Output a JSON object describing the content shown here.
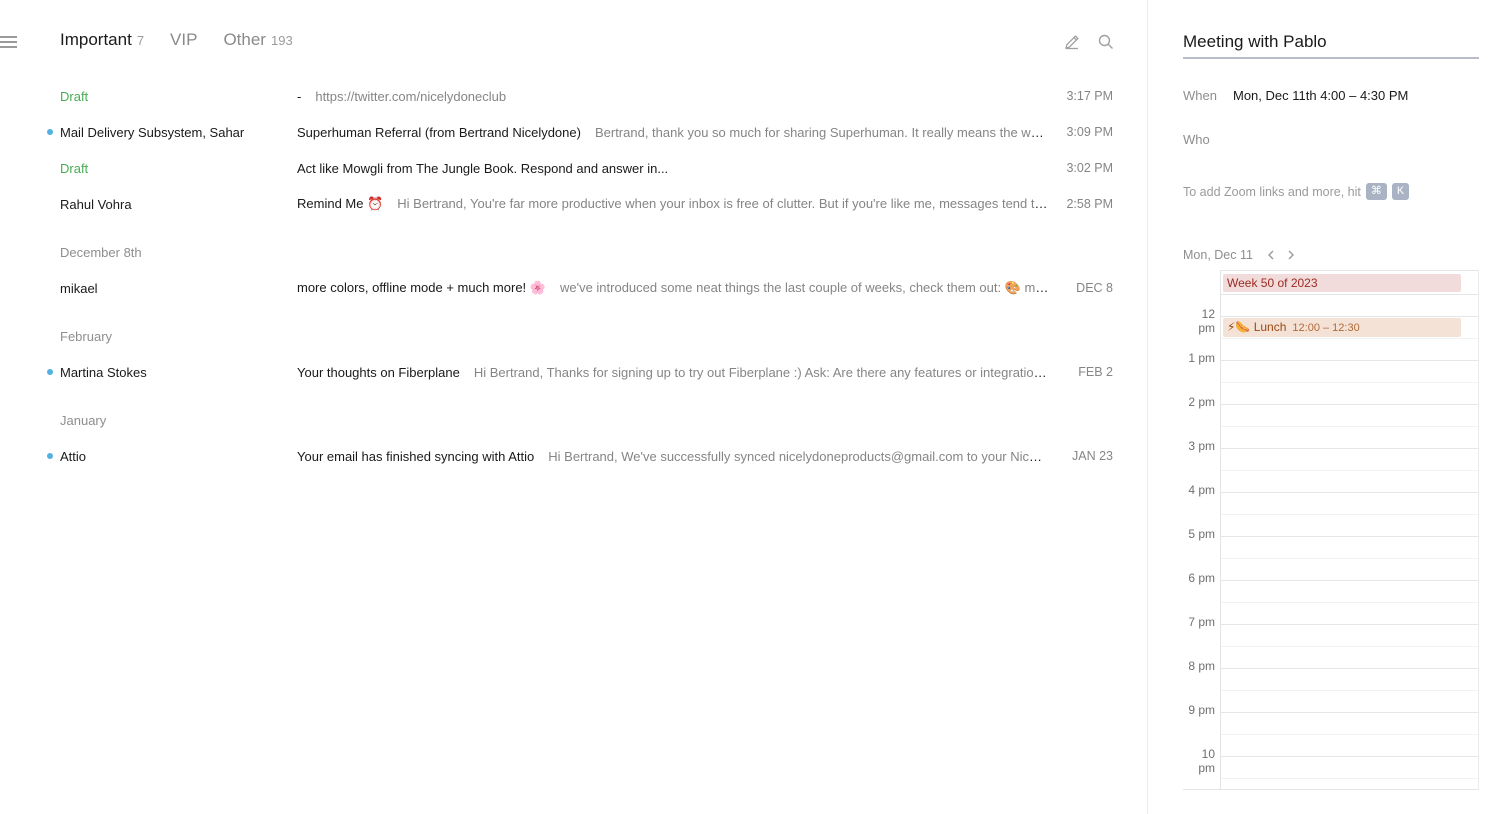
{
  "tabs": [
    {
      "label": "Important",
      "count": "7"
    },
    {
      "label": "VIP",
      "count": ""
    },
    {
      "label": "Other",
      "count": "193"
    }
  ],
  "icons": {
    "menu": "hamburger-menu-icon",
    "compose": "pencil-icon",
    "search": "search-icon"
  },
  "emails": [
    {
      "sender": "Draft",
      "draft": true,
      "unread": false,
      "subject": "-",
      "preview": "https://twitter.com/nicelydoneclub",
      "time": "3:17 PM"
    },
    {
      "sender": "Mail Delivery Subsystem, Sahar",
      "draft": false,
      "unread": true,
      "subject": "Superhuman Referral (from Bertrand Nicelydone)",
      "preview": "Bertrand, thank you so much for sharing Superhuman. It really means the world to us. ...",
      "time": "3:09 PM"
    },
    {
      "sender": "Draft",
      "draft": true,
      "unread": false,
      "subject": "Act like Mowgli from The Jungle Book. Respond and answer in...",
      "preview": "",
      "time": "3:02 PM"
    },
    {
      "sender": "Rahul Vohra",
      "draft": false,
      "unread": false,
      "subject": "Remind Me ⏰",
      "preview": "Hi Bertrand, You're far more productive when your inbox is free of clutter. But if you're like me, messages tend to pile up. ...",
      "time": "2:58 PM"
    }
  ],
  "groups": [
    {
      "label": "December 8th",
      "emails": [
        {
          "sender": "mikael",
          "draft": false,
          "unread": false,
          "subject": "more colors, offline mode + much more! 🌸",
          "preview": "we've introduced some neat things the last couple of weeks, check them out: 🎨 more colors...",
          "time": "DEC 8"
        }
      ]
    },
    {
      "label": "February",
      "emails": [
        {
          "sender": "Martina Stokes",
          "draft": false,
          "unread": true,
          "subject": "Your thoughts on Fiberplane",
          "preview": "Hi Bertrand, Thanks for signing up to try out Fiberplane :) Ask: Are there any features or integrations you're...",
          "time": "FEB 2"
        }
      ]
    },
    {
      "label": "January",
      "emails": [
        {
          "sender": "Attio",
          "draft": false,
          "unread": true,
          "subject": "Your email has finished syncing with Attio",
          "preview": "Hi Bertrand, We've successfully synced nicelydoneproducts@gmail.com to your Nicelydone...",
          "time": "JAN 23"
        }
      ]
    }
  ],
  "meeting": {
    "title": "Meeting with Pablo",
    "when_label": "When",
    "when_value": "Mon, Dec 11th 4:00 – 4:30 PM",
    "who_label": "Who",
    "zoom_hint": "To add Zoom links and more, hit",
    "kbd_cmd": "⌘",
    "kbd_k": "K"
  },
  "calendar": {
    "date": "Mon, Dec 11",
    "hours": [
      "12 pm",
      "1 pm",
      "2 pm",
      "3 pm",
      "4 pm",
      "5 pm",
      "6 pm",
      "7 pm",
      "8 pm",
      "9 pm",
      "10 pm"
    ],
    "allday_event": "Week 50 of 2023",
    "lunch_event": {
      "title": "⚡🌭 Lunch",
      "time": "12:00 – 12:30"
    }
  },
  "colors": {
    "unread_dot": "#52b1e0",
    "draft": "#4aad54",
    "allday_bg": "#f1dcdb",
    "lunch_bg": "#f5e2d7"
  }
}
